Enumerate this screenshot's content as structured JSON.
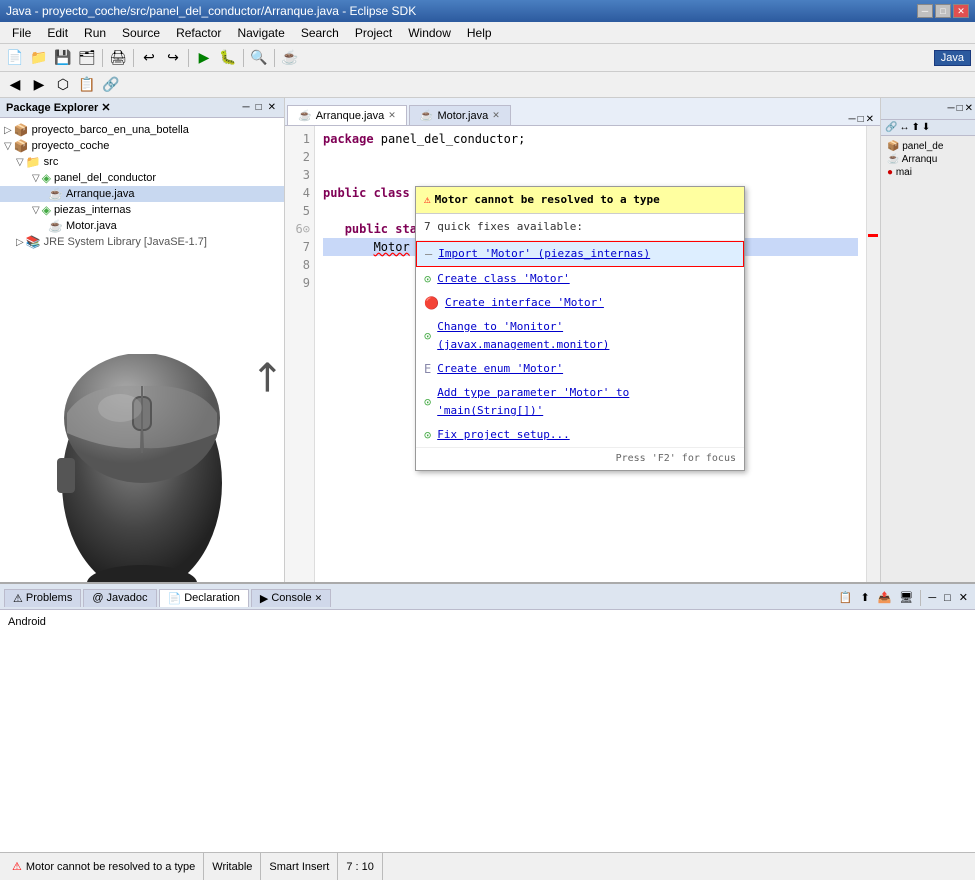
{
  "titlebar": {
    "title": "Java - proyecto_coche/src/panel_del_conductor/Arranque.java - Eclipse SDK",
    "controls": [
      "minimize",
      "maximize",
      "close"
    ]
  },
  "menubar": {
    "items": [
      "File",
      "Edit",
      "Run",
      "Source",
      "Refactor",
      "Navigate",
      "Search",
      "Project",
      "Window",
      "Help"
    ]
  },
  "toolbar": {
    "java_label": "Java"
  },
  "package_explorer": {
    "title": "Package Explorer",
    "items": [
      {
        "label": "proyecto_barco_en_una_botella",
        "indent": 0,
        "type": "project",
        "arrow": "▷"
      },
      {
        "label": "proyecto_coche",
        "indent": 0,
        "type": "project",
        "arrow": "▽"
      },
      {
        "label": "src",
        "indent": 1,
        "type": "folder",
        "arrow": "▽"
      },
      {
        "label": "panel_del_conductor",
        "indent": 2,
        "type": "package",
        "arrow": "▽"
      },
      {
        "label": "Arranque.java",
        "indent": 3,
        "type": "java",
        "arrow": ""
      },
      {
        "label": "piezas_internas",
        "indent": 2,
        "type": "package",
        "arrow": "▽"
      },
      {
        "label": "Motor.java",
        "indent": 3,
        "type": "java",
        "arrow": ""
      },
      {
        "label": "JRE System Library [JavaSE-1.7]",
        "indent": 1,
        "type": "library",
        "arrow": "▷"
      }
    ]
  },
  "editor": {
    "tabs": [
      {
        "label": "Arranque.java",
        "active": true
      },
      {
        "label": "Motor.java",
        "active": false
      }
    ],
    "lines": [
      {
        "num": 1,
        "text": "package panel_del_conductor;",
        "highlight": false
      },
      {
        "num": 2,
        "text": "",
        "highlight": false
      },
      {
        "num": 3,
        "text": "",
        "highlight": false
      },
      {
        "num": 4,
        "text": "public class Arranque {",
        "highlight": false
      },
      {
        "num": 5,
        "text": "",
        "highlight": false
      },
      {
        "num": 6,
        "text": "    public static void main(String[] args) {",
        "highlight": false
      },
      {
        "num": 7,
        "text": "        Motor mi_motor = new Motor (20);",
        "highlight": true
      },
      {
        "num": 8,
        "text": "",
        "highlight": false
      },
      {
        "num": 9,
        "text": "",
        "highlight": false
      }
    ]
  },
  "quickfix": {
    "error_msg": "Motor cannot be resolved to a type",
    "subtitle": "7 quick fixes available:",
    "items": [
      {
        "icon": "import",
        "label": "Import 'Motor' (piezas_internas)",
        "selected": true,
        "link": true
      },
      {
        "icon": "class",
        "label": "Create class 'Motor'",
        "selected": false,
        "link": true
      },
      {
        "icon": "interface",
        "label": "Create interface 'Motor'",
        "selected": false,
        "link": true
      },
      {
        "icon": "change",
        "label": "Change to 'Monitor' (javax.management.monitor)",
        "selected": false,
        "link": true
      },
      {
        "icon": "enum",
        "label": "Create enum 'Motor'",
        "selected": false,
        "link": true
      },
      {
        "icon": "param",
        "label": "Add type parameter 'Motor' to 'main(String[])'",
        "selected": false,
        "link": true
      },
      {
        "icon": "project",
        "label": "Fix project setup...",
        "selected": false,
        "link": true
      }
    ],
    "footer": "Press 'F2' for focus"
  },
  "right_panel": {
    "items": [
      "panel_de",
      "Arranqu",
      "mai"
    ]
  },
  "bottom_panel": {
    "tabs": [
      {
        "label": "Problems",
        "icon": "⚠",
        "active": false
      },
      {
        "label": "Javadoc",
        "icon": "@",
        "active": false
      },
      {
        "label": "Declaration",
        "icon": "📄",
        "active": true
      },
      {
        "label": "Console",
        "icon": "▶",
        "active": false
      }
    ],
    "content": "Android"
  },
  "statusbar": {
    "message": "Motor cannot be resolved to a type",
    "writable": "Writable",
    "insert_mode": "Smart Insert",
    "position": "7 : 10"
  }
}
